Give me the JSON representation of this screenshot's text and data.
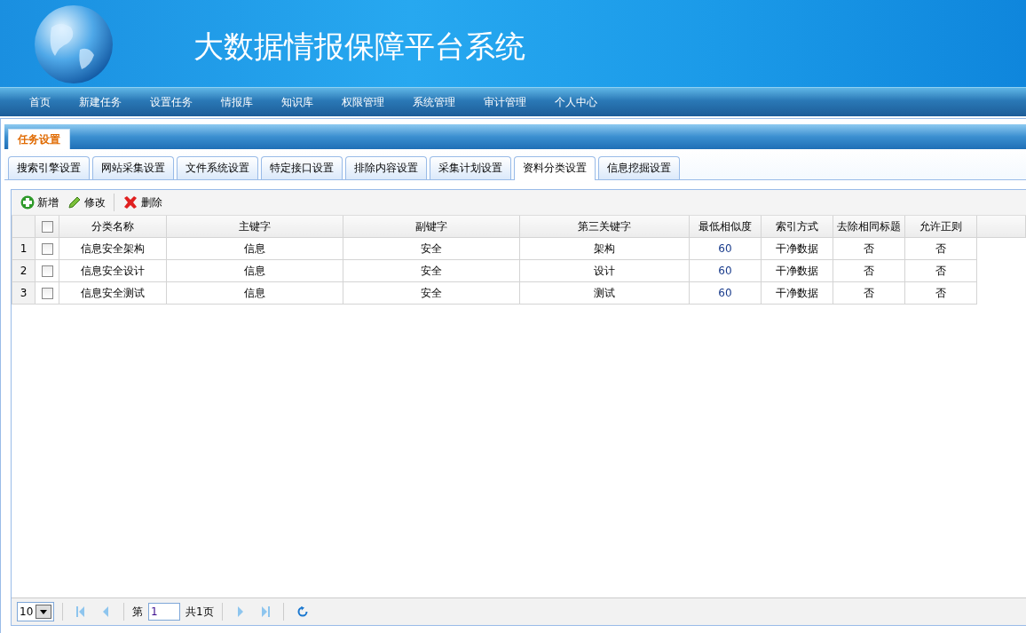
{
  "header": {
    "title": "大数据情报保障平台系统"
  },
  "nav": {
    "items": [
      "首页",
      "新建任务",
      "设置任务",
      "情报库",
      "知识库",
      "权限管理",
      "系统管理",
      "审计管理",
      "个人中心"
    ]
  },
  "panel": {
    "title": "任务设置"
  },
  "tabs": [
    {
      "label": "搜索引擎设置",
      "selected": false
    },
    {
      "label": "网站采集设置",
      "selected": false
    },
    {
      "label": "文件系统设置",
      "selected": false
    },
    {
      "label": "特定接口设置",
      "selected": false
    },
    {
      "label": "排除内容设置",
      "selected": false
    },
    {
      "label": "采集计划设置",
      "selected": false
    },
    {
      "label": "资料分类设置",
      "selected": true
    },
    {
      "label": "信息挖掘设置",
      "selected": false
    }
  ],
  "toolbar": [
    {
      "kind": "add",
      "label": "新增"
    },
    {
      "kind": "edit",
      "label": "修改"
    },
    {
      "kind": "delete",
      "label": "删除"
    }
  ],
  "table": {
    "select_all_checked": false,
    "columns": [
      "分类名称",
      "主键字",
      "副键字",
      "第三关键字",
      "最低相似度",
      "索引方式",
      "去除相同标题",
      "允许正则"
    ],
    "rows": [
      {
        "index": "1",
        "checked": false,
        "cells": [
          "信息安全架构",
          "信息",
          "安全",
          "架构",
          "60",
          "干净数据",
          "否",
          "否"
        ]
      },
      {
        "index": "2",
        "checked": false,
        "cells": [
          "信息安全设计",
          "信息",
          "安全",
          "设计",
          "60",
          "干净数据",
          "否",
          "否"
        ]
      },
      {
        "index": "3",
        "checked": false,
        "cells": [
          "信息安全测试",
          "信息",
          "安全",
          "测试",
          "60",
          "干净数据",
          "否",
          "否"
        ]
      }
    ]
  },
  "pager": {
    "page_size": "10",
    "page_label": "第",
    "page": "1",
    "total_label": "共1页"
  }
}
